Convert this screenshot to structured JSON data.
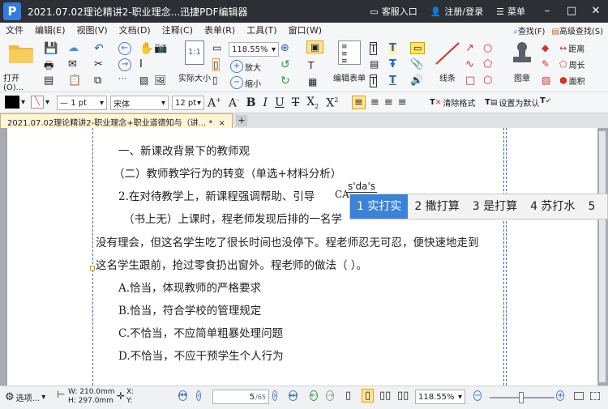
{
  "titlebar": {
    "title": "2021.07.02理论精讲2-职业理念...迅捷PDF编辑器",
    "service": "客服入口",
    "login": "注册/登录",
    "menu": "菜单",
    "min": "–",
    "max": "□",
    "close": "✕"
  },
  "menubar": {
    "items": [
      "文件",
      "编辑(E)",
      "视图(V)",
      "文档(D)",
      "注释(C)",
      "表单(R)",
      "工具(T)",
      "窗口(W)"
    ],
    "find": "查找(F)",
    "adv_find": "高级查找(S)"
  },
  "ribbon": {
    "open": "打开(O)...",
    "actual_size": "实际大小",
    "zoom": "118.55%",
    "zoom_in": "放大",
    "zoom_out": "缩小",
    "edit_form": "编辑表单",
    "lines": "线条",
    "stamp": "图章",
    "distance": "距离",
    "perimeter": "周长",
    "area": "面积"
  },
  "format": {
    "line_width": "1 pt",
    "font": "宋体",
    "font_size": "12 pt",
    "clear_format": "清除格式",
    "set_default": "设置为默认"
  },
  "tab": {
    "label": "2021.07.02理论精讲2-职业理念+职业道德知与（讲...",
    "star": "*",
    "close": "×",
    "add": "+"
  },
  "document": {
    "lines": [
      "一、新课改背景下的教师观",
      "（二）教师教学行为的转变（单选+材料分析）",
      "2.在对待教学上，新课程强调帮助、引导",
      "（书上无）上课时，程老师发现后排的一名学",
      "没有理会，但这名学生吃了很长时间也没停下。程老师忍无可忍，便快速地走到",
      "这名学生跟前，抢过零食扔出窗外。程老师的做法（    ）。",
      "A.恰当，体现教师的严格要求",
      "B.恰当，符合学校的管理规定",
      "C.不恰当，不应简单粗暴处理问题",
      "D.不恰当，不应干预学生个人行为"
    ],
    "ca_fragment": "CA"
  },
  "ime": {
    "input": "s'da's",
    "candidates": [
      "1 实打实",
      "2 撒打算",
      "3 是打算",
      "4 苏打水",
      "5"
    ]
  },
  "status": {
    "options": "选项...",
    "width": "W: 210.0mm",
    "height": "H: 297.0mm",
    "x": "X:",
    "y": "Y:",
    "page_current": "5",
    "page_total": "/65",
    "zoom": "118.55%"
  }
}
